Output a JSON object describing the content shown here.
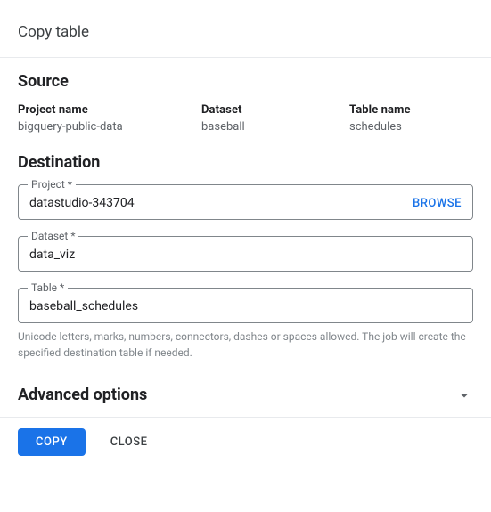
{
  "dialog": {
    "title": "Copy table",
    "source": {
      "heading": "Source",
      "project_label": "Project name",
      "project_value": "bigquery-public-data",
      "dataset_label": "Dataset",
      "dataset_value": "baseball",
      "table_label": "Table name",
      "table_value": "schedules"
    },
    "destination": {
      "heading": "Destination",
      "project_label": "Project *",
      "project_value": "datastudio-343704",
      "browse_label": "BROWSE",
      "dataset_label": "Dataset *",
      "dataset_value": "data_viz",
      "table_label": "Table *",
      "table_value": "baseball_schedules",
      "table_help": "Unicode letters, marks, numbers, connectors, dashes or spaces allowed. The job will create the specified destination table if needed."
    },
    "advanced": {
      "heading": "Advanced options"
    },
    "footer": {
      "copy": "COPY",
      "close": "CLOSE"
    }
  }
}
